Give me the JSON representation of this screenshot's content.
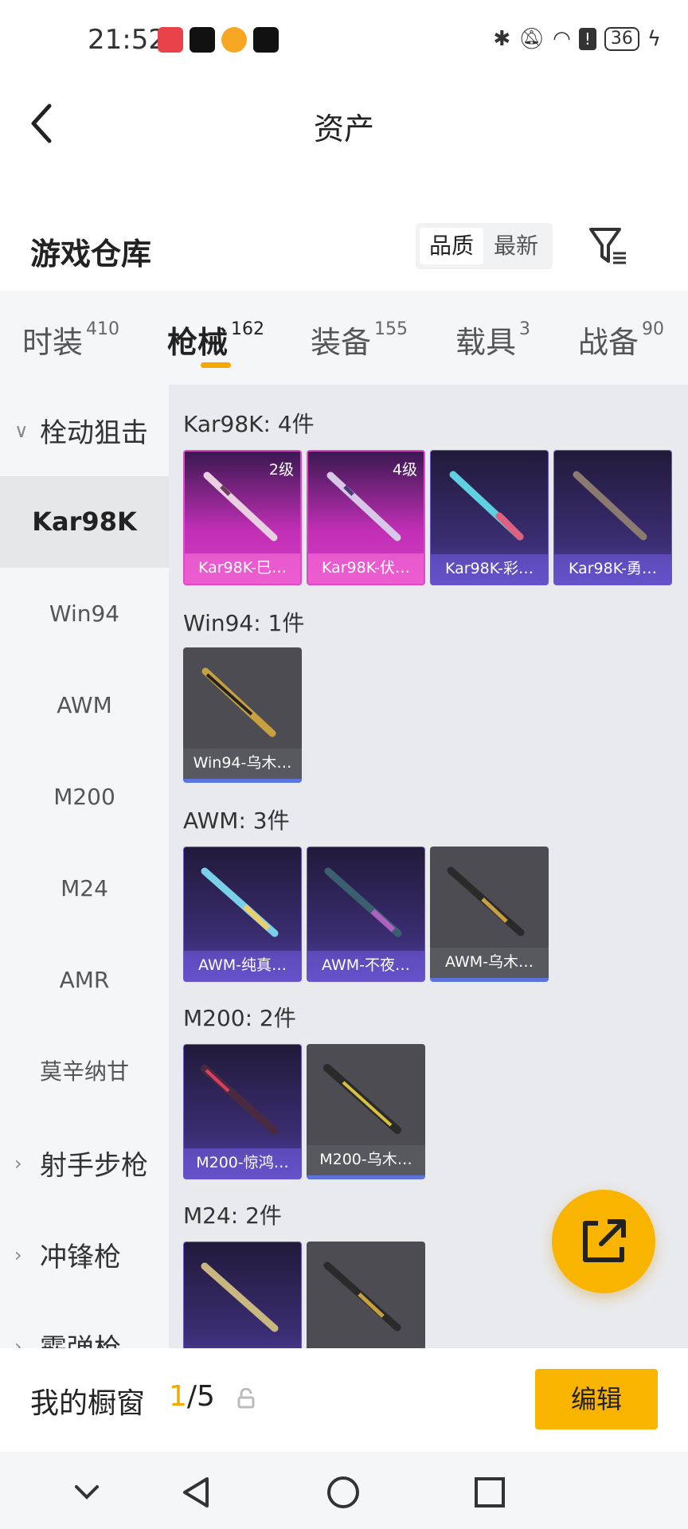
{
  "status": {
    "time": "21:52",
    "battery": "36"
  },
  "header": {
    "title": "资产"
  },
  "section": {
    "title": "游戏仓库",
    "sort_quality": "品质",
    "sort_latest": "最新"
  },
  "tabs": [
    {
      "label": "时装",
      "count": "410"
    },
    {
      "label": "枪械",
      "count": "162"
    },
    {
      "label": "装备",
      "count": "155"
    },
    {
      "label": "载具",
      "count": "3"
    },
    {
      "label": "战备",
      "count": "90"
    }
  ],
  "sidebar": {
    "group1": "栓动狙击",
    "items": [
      "Kar98K",
      "Win94",
      "AWM",
      "M200",
      "M24",
      "AMR",
      "莫辛纳甘"
    ],
    "group2": "射手步枪",
    "group3": "冲锋枪",
    "group4": "霰弹枪"
  },
  "groups": [
    {
      "title": "Kar98K: 4件"
    },
    {
      "title": "Win94: 1件"
    },
    {
      "title": "AWM: 3件"
    },
    {
      "title": "M200: 2件"
    },
    {
      "title": "M24: 2件"
    }
  ],
  "cards": {
    "k1": {
      "name": "Kar98K-巳…",
      "level": "2级"
    },
    "k2": {
      "name": "Kar98K-伏…",
      "level": "4级"
    },
    "k3": {
      "name": "Kar98K-彩…"
    },
    "k4": {
      "name": "Kar98K-勇…"
    },
    "w1": {
      "name": "Win94-乌木…"
    },
    "a1": {
      "name": "AWM-纯真…"
    },
    "a2": {
      "name": "AWM-不夜…"
    },
    "a3": {
      "name": "AWM-乌木…"
    },
    "m1": {
      "name": "M200-惊鸿…"
    },
    "m2": {
      "name": "M200-乌木…"
    }
  },
  "bottom": {
    "title": "我的橱窗",
    "count_current": "1",
    "count_total": "/5",
    "edit": "编辑"
  },
  "colors": {
    "accent": "#f9b400",
    "pink_rarity": "#d53cbf",
    "purple_rarity": "#5b46b0"
  }
}
